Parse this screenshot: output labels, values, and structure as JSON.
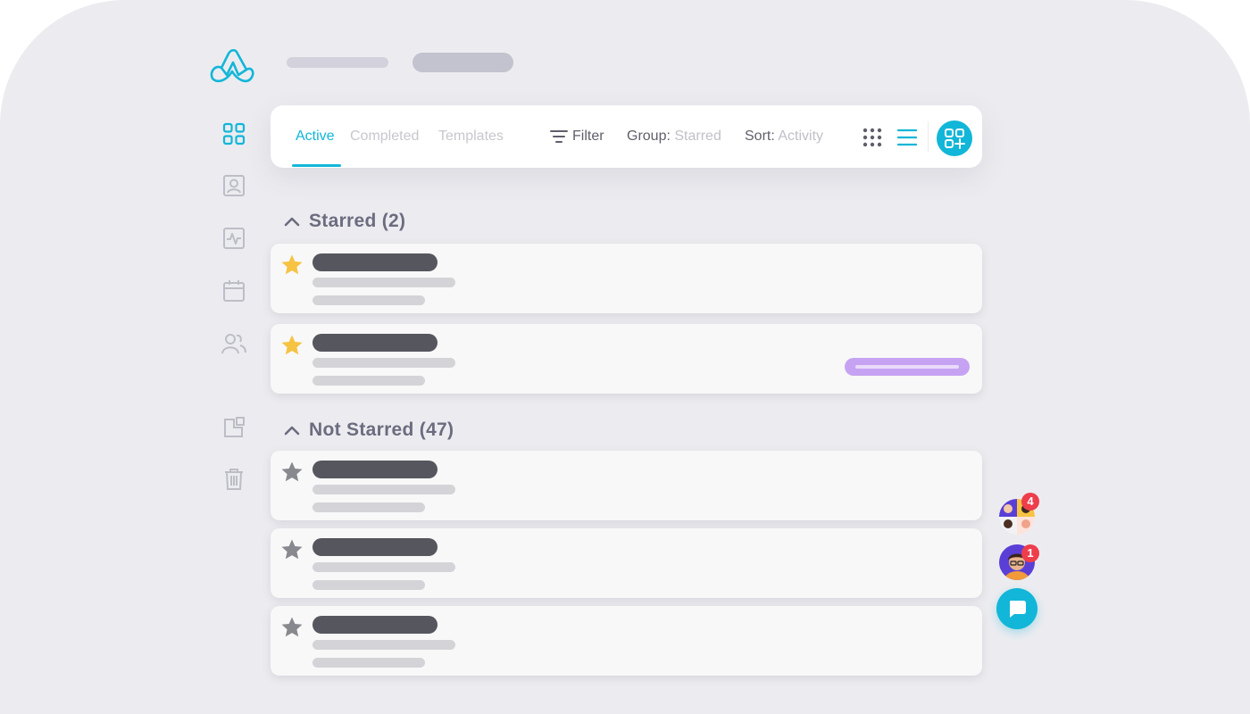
{
  "colors": {
    "accent": "#12b6d8",
    "star_active": "#f6c343",
    "star_inactive": "#88888f",
    "badge": "#ee3d4b",
    "tag": "#c6a3f2"
  },
  "header": {
    "logo_icon": "zapflow-logo-icon",
    "breadcrumb_icons": [
      "breadcrumb-placeholder",
      "breadcrumb-placeholder"
    ]
  },
  "sidebar": {
    "items": [
      {
        "icon": "grid-icon",
        "active": true
      },
      {
        "icon": "contact-card-icon",
        "active": false
      },
      {
        "icon": "activity-icon",
        "active": false
      },
      {
        "icon": "calendar-icon",
        "active": false
      },
      {
        "icon": "users-icon",
        "active": false
      },
      {
        "icon": "archive-icon",
        "active": false
      },
      {
        "icon": "trash-icon",
        "active": false
      }
    ]
  },
  "toolbar": {
    "tabs": [
      {
        "label": "Active",
        "active": true
      },
      {
        "label": "Completed",
        "active": false
      },
      {
        "label": "Templates",
        "active": false
      }
    ],
    "filter_label": "Filter",
    "group_label": "Group:",
    "group_value": "Starred",
    "sort_label": "Sort:",
    "sort_value": "Activity",
    "view_modes": [
      "grid-view-icon",
      "list-view-icon"
    ],
    "active_view": "list",
    "add_icon": "add-board-icon"
  },
  "sections": [
    {
      "title": "Starred (2)",
      "expanded": true
    },
    {
      "title": "Not Starred (47)",
      "expanded": true
    }
  ],
  "cards": [
    {
      "section": 0,
      "starred": true,
      "has_tag": false
    },
    {
      "section": 0,
      "starred": true,
      "has_tag": true
    },
    {
      "section": 1,
      "starred": false,
      "has_tag": false
    },
    {
      "section": 1,
      "starred": false,
      "has_tag": false
    },
    {
      "section": 1,
      "starred": false,
      "has_tag": false
    }
  ],
  "floating": {
    "group_avatar_badge": "4",
    "single_avatar_badge": "1",
    "chat_icon": "chat-bubble-icon"
  }
}
